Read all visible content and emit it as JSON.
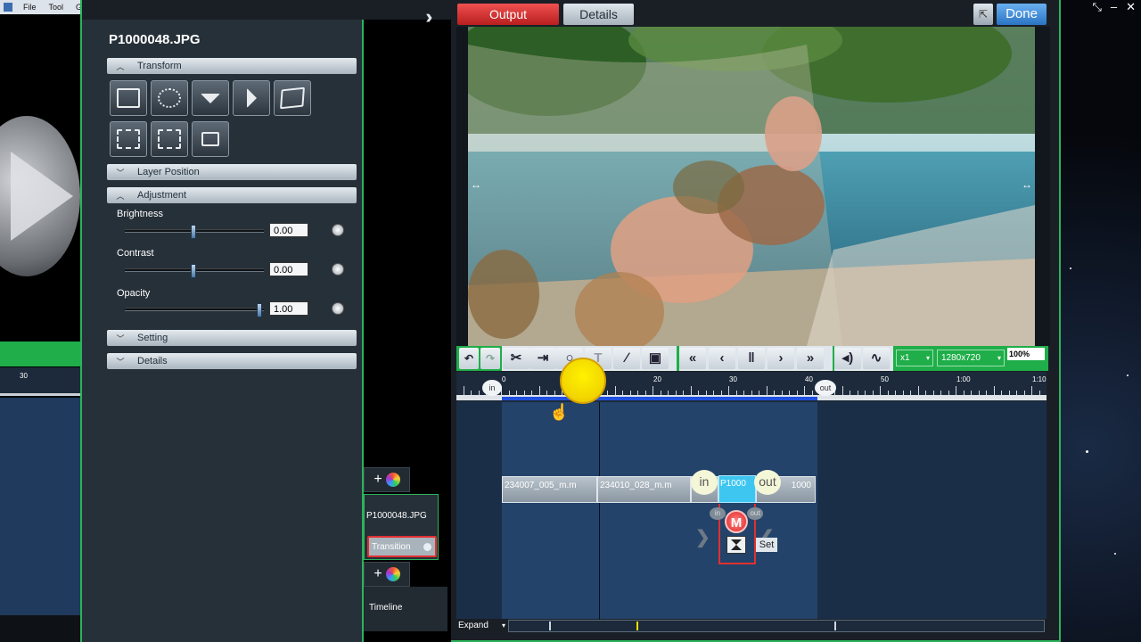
{
  "menubar": {
    "items": [
      "File",
      "Tool",
      "Guide"
    ]
  },
  "header": {
    "tab_output": "Output",
    "tab_details": "Details",
    "done": "Done"
  },
  "props": {
    "file_title": "P1000048.JPG",
    "sections": {
      "transform": "Transform",
      "layer_position": "Layer Position",
      "adjustment": "Adjustment",
      "setting": "Setting",
      "details": "Details"
    },
    "adjustment": {
      "brightness_label": "Brightness",
      "brightness_value": "0.00",
      "brightness_level": 0.5,
      "contrast_label": "Contrast",
      "contrast_value": "0.00",
      "contrast_level": 0.5,
      "opacity_label": "Opacity",
      "opacity_value": "1.00",
      "opacity_level": 1.0
    },
    "transform_icons": [
      "fit-icon",
      "rotate-icon",
      "flip-vertical-icon",
      "flip-horizontal-icon",
      "skew-icon",
      "crop-center-icon",
      "crop-left-icon",
      "crop-small-icon"
    ]
  },
  "tracks": {
    "track_name": "P1000048.JPG",
    "transition_label": "Transition",
    "timeline_label": "Timeline"
  },
  "controls": {
    "speed": "x1",
    "resolution": "1280x720",
    "zoom": "100%"
  },
  "ruler": {
    "labels": [
      "0",
      "20",
      "30",
      "40",
      "50",
      "1:00",
      "1:10"
    ],
    "left_label": "30",
    "in_label": "in",
    "out_label": "out"
  },
  "timeline": {
    "clips": [
      "234007_005_m.m",
      "234010_028_m.m",
      "P1000",
      "1000"
    ],
    "in_bubble": "in",
    "out_bubble": "out",
    "small_in": "in",
    "small_out": "out",
    "m_badge": "M",
    "set_label": "Set"
  },
  "bottom": {
    "expand_label": "Expand"
  },
  "colors": {
    "accent_green": "#1fae49",
    "output_red": "#d03030",
    "done_blue": "#3a86d8",
    "range_blue": "#2050e0"
  }
}
